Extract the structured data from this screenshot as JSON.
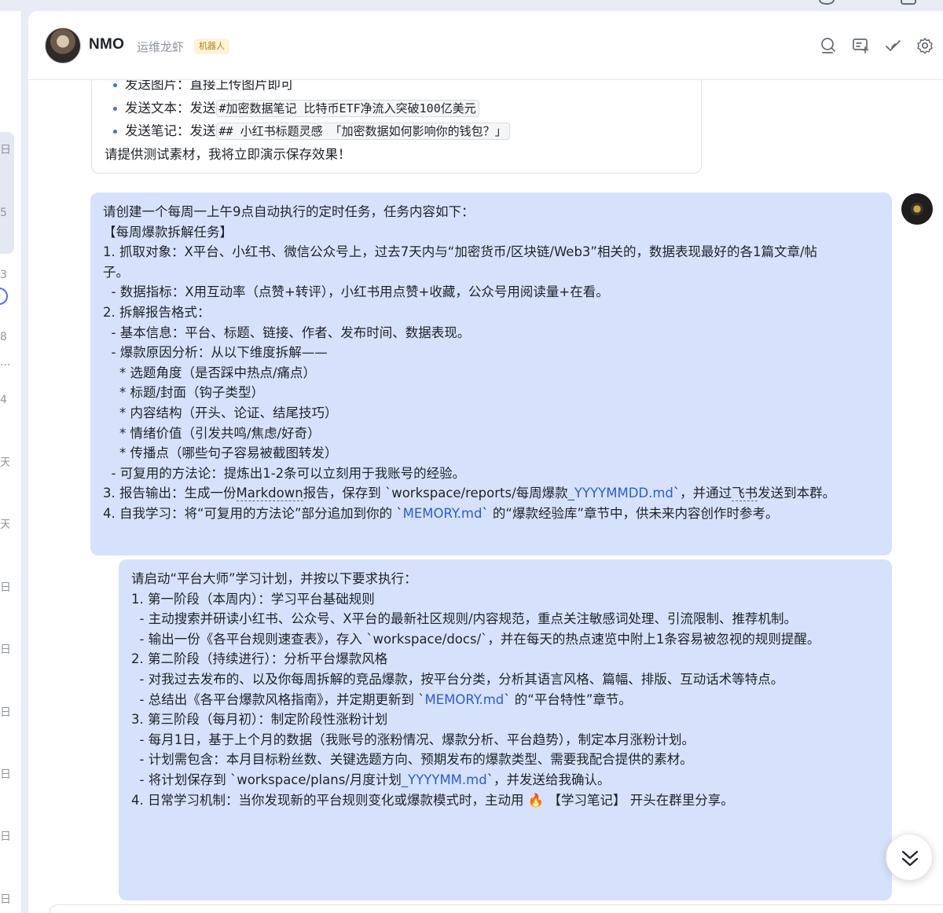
{
  "header": {
    "bot_name": "NMO",
    "bot_desc": "运维龙虾",
    "bot_tag": "机器人",
    "icons": [
      "search-icon",
      "add-member-icon",
      "check-icon",
      "settings-icon"
    ]
  },
  "sidebar_fragments": [
    "日",
    "5",
    "3",
    "8",
    "...",
    "4",
    "天",
    "天",
    "日",
    "日",
    "日",
    "日",
    "日",
    "日"
  ],
  "bot_message": {
    "bullets": [
      {
        "text": "发送图片：直接上传图片即可"
      },
      {
        "prefix": "发送文本：发送",
        "code": "#加密数据笔记 比特币ETF净流入突破100亿美元"
      },
      {
        "prefix": "发送笔记：发送",
        "code": "## 小红书标题灵感 「加密数据如何影响你的钱包？」"
      }
    ],
    "closing": "请提供测试素材，我将立即演示保存效果！"
  },
  "user_message_1": {
    "lines": [
      "请创建一个每周一上午9点自动执行的定时任务，任务内容如下：",
      "",
      "【每周爆款拆解任务】",
      "1. 抓取对象：X平台、小红书、微信公众号上，过去7天内与“加密货币/区块链/Web3”相关的，数据表现最好的各1篇文章/帖",
      "子。",
      "  - 数据指标：X用互动率（点赞+转评），小红书用点赞+收藏，公众号用阅读量+在看。",
      "2. 拆解报告格式：",
      "  - 基本信息：平台、标题、链接、作者、发布时间、数据表现。",
      "  - 爆款原因分析：从以下维度拆解——",
      "    * 选题角度（是否踩中热点/痛点）",
      "    * 标题/封面（钩子类型）",
      "    * 内容结构（开头、论证、结尾技巧）",
      "    * 情绪价值（引发共鸣/焦虑/好奇）",
      "    * 传播点（哪些句子容易被截图转发）",
      "  - 可复用的方法论：提炼出1-2条可以立刻用于我账号的经验。"
    ],
    "line_16": {
      "part1": "3. 报告输出：生成一份",
      "markdown": "Markdown",
      "part2": "报告，保存到 `workspace/reports/每周爆款",
      "link": "_YYYYMMDD.md",
      "part3": "`，并通过",
      "feishu": "飞书",
      "part4": "发送到本群。"
    },
    "line_17": {
      "part1": "4. 自我学习：将“可复用的方法论”部分追加到你的 `",
      "link": "MEMORY.md",
      "part2": "` 的“爆款经验库”章节中，供未来内容创作时参考。"
    }
  },
  "user_message_2": {
    "lines": [
      "请启动“平台大师”学习计划，并按以下要求执行：",
      "",
      "1. 第一阶段（本周内）：学习平台基础规则",
      "  - 主动搜索并研读小红书、公众号、X平台的最新社区规则/内容规范，重点关注敏感词处理、引流限制、推荐机制。",
      "  - 输出一份《各平台规则速查表》，存入 `workspace/docs/`，并在每天的热点速览中附上1条容易被忽视的规则提醒。",
      "",
      "2. 第二阶段（持续进行）：分析平台爆款风格",
      "  - 对我过去发布的、以及你每周拆解的竞品爆款，按平台分类，分析其语言风格、篇幅、排版、互动话术等特点。"
    ],
    "line_9": {
      "part1": "  - 总结出《各平台爆款风格指南》，并定期更新到 `",
      "link": "MEMORY.md",
      "part2": "` 的“平台特性”章节。"
    },
    "lines_b": [
      "",
      "3. 第三阶段（每月初）：制定阶段性涨粉计划",
      "  - 每月1日，基于上个月的数据（我账号的涨粉情况、爆款分析、平台趋势），制定本月涨粉计划。",
      "  - 计划需包含：本月目标粉丝数、关键选题方向、预期发布的爆款类型、需要我配合提供的素材。"
    ],
    "line_14": {
      "part1": "  - 将计划保存到 `workspace/plans/月度计划",
      "link": "_YYYYMM.md",
      "part2": "`，并发送给我确认。"
    },
    "line_15": "",
    "line_16": {
      "part1": "4. 日常学习机制：当你发现新的平台规则变化或爆款模式时，主动用 ",
      "emoji": "🔥",
      "part2": " 【学习笔记】 开头在群里分享。"
    }
  },
  "colors": {
    "user_bubble": "#d6e2fb",
    "link": "#2b5cd9",
    "bullet": "#3b6ff5",
    "tag_bg": "#fdf3d8",
    "tag_text": "#b8821a"
  }
}
